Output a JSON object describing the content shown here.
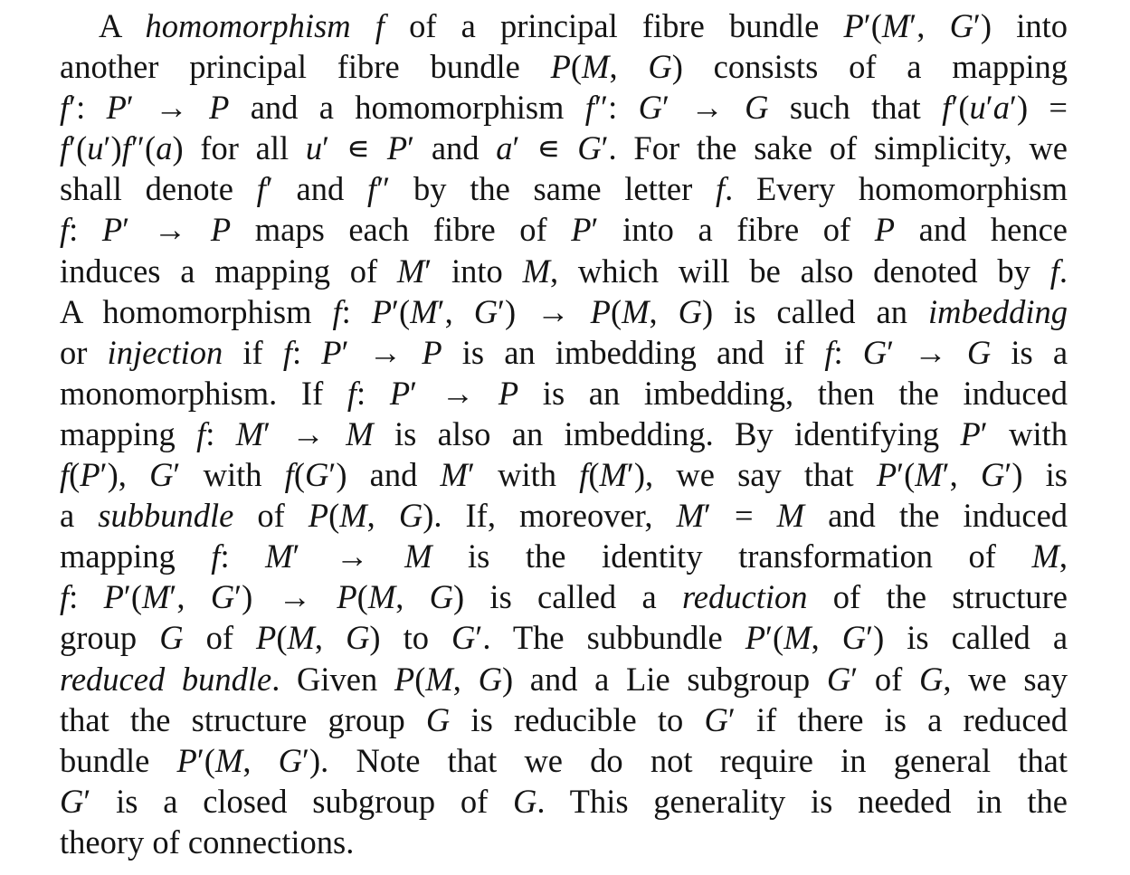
{
  "paragraph": {
    "lines": [
      {
        "html": "A <i>homomorphism f</i> of a principal fibre bundle <i>P</i>′(<i>M</i>′, <i>G</i>′) into"
      },
      {
        "html": "another principal fibre bundle <i>P</i>(<i>M</i>, <i>G</i>) consists of a mapping"
      },
      {
        "html": "<i>f</i>′: <i>P</i>′ → <i>P</i> and a homomorphism <i>f</i>″: <i>G</i>′ → <i>G</i> such that <i>f</i>′(<i>u</i>′<i>a</i>′) ="
      },
      {
        "html": "<i>f</i>′(<i>u</i>′)<i>f</i>″(<i>a</i>) for all <i>u</i>′ ∊ <i>P</i>′ and <i>a</i>′ ∊ <i>G</i>′. For the sake of simplicity, we"
      },
      {
        "html": "shall denote <i>f</i>′ and <i>f</i>″ by the same letter <i>f</i>. Every homomorphism"
      },
      {
        "html": "<i>f</i>: <i>P</i>′ → <i>P</i> maps each fibre of <i>P</i>′ into a fibre of <i>P</i> and hence"
      },
      {
        "html": "induces a mapping of <i>M</i>′ into <i>M</i>, which will be also denoted by <i>f</i>."
      },
      {
        "html": "A homomorphism <i>f</i>: <i>P</i>′(<i>M</i>′, <i>G</i>′) → <i>P</i>(<i>M</i>, <i>G</i>) is called an <i>imbedding</i>"
      },
      {
        "html": "or <i>injection</i> if <i>f</i>: <i>P</i>′ → <i>P</i> is an imbedding and if <i>f</i>: <i>G</i>′ → <i>G</i> is a"
      },
      {
        "html": "monomorphism. If <i>f</i>: <i>P</i>′ → <i>P</i> is an imbedding, then the induced"
      },
      {
        "html": "mapping <i>f</i>: <i>M</i>′ → <i>M</i> is also an imbedding. By identifying <i>P</i>′ with"
      },
      {
        "html": "<i>f</i>(<i>P</i>′), <i>G</i>′ with <i>f</i>(<i>G</i>′) and <i>M</i>′ with <i>f</i>(<i>M</i>′), we say that <i>P</i>′(<i>M</i>′, <i>G</i>′) is"
      },
      {
        "html": "a <i>subbundle</i> of <i>P</i>(<i>M</i>, <i>G</i>). If, moreover, <i>M</i>′ = <i>M</i> and the induced"
      },
      {
        "html": "mapping <i>f</i>: <i>M</i>′ → <i>M</i> is the identity transformation of <i>M</i>,"
      },
      {
        "html": "<i>f</i>: <i>P</i>′(<i>M</i>′, <i>G</i>′) → <i>P</i>(<i>M</i>, <i>G</i>) is called a <i>reduction</i> of the structure"
      },
      {
        "html": "group <i>G</i> of <i>P</i>(<i>M</i>, <i>G</i>) to <i>G</i>′. The subbundle <i>P</i>′(<i>M</i>, <i>G</i>′) is called a"
      },
      {
        "html": "<i>reduced bundle</i>. Given <i>P</i>(<i>M</i>, <i>G</i>) and a Lie subgroup <i>G</i>′ of <i>G</i>, we say"
      },
      {
        "html": "that the structure group <i>G</i> is reducible to <i>G</i>′ if there is a reduced"
      },
      {
        "html": "bundle <i>P</i>′(<i>M</i>, <i>G</i>′). Note that we do not require in general that"
      },
      {
        "html": "<i>G</i>′ is a closed subgroup of <i>G</i>. This generality is needed in the"
      },
      {
        "html": "theory of connections."
      }
    ]
  },
  "colors": {
    "text": "#141414",
    "background": "#ffffff"
  }
}
